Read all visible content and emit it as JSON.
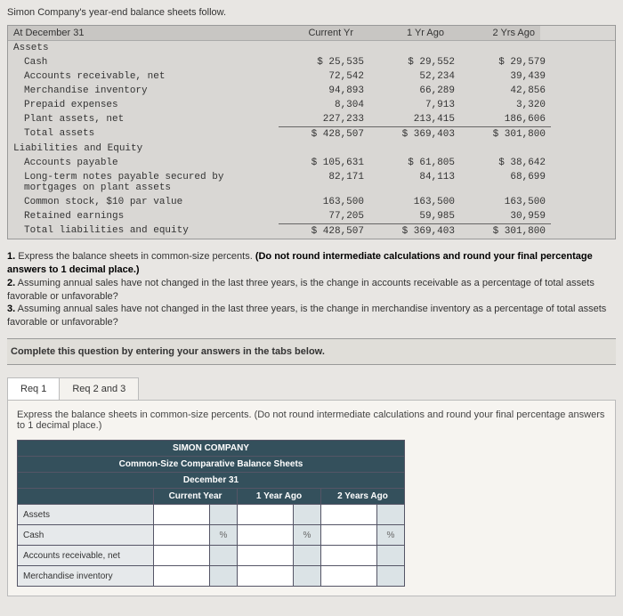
{
  "title": "Simon Company's year-end balance sheets follow.",
  "bs": {
    "date_label": "At December 31",
    "cols": [
      "Current Yr",
      "1 Yr Ago",
      "2 Yrs Ago"
    ],
    "sections": {
      "assets_hdr": "Assets",
      "liab_hdr": "Liabilities and Equity"
    },
    "rows": {
      "cash": {
        "label": "Cash",
        "v": [
          "$ 25,535",
          "$ 29,552",
          "$ 29,579"
        ]
      },
      "ar": {
        "label": "Accounts receivable, net",
        "v": [
          "72,542",
          "52,234",
          "39,439"
        ]
      },
      "merch": {
        "label": "Merchandise inventory",
        "v": [
          "94,893",
          "66,289",
          "42,856"
        ]
      },
      "prepaid": {
        "label": "Prepaid expenses",
        "v": [
          "8,304",
          "7,913",
          "3,320"
        ]
      },
      "plant": {
        "label": "Plant assets, net",
        "v": [
          "227,233",
          "213,415",
          "186,606"
        ]
      },
      "total_assets": {
        "label": "Total assets",
        "v": [
          "$ 428,507",
          "$ 369,403",
          "$ 301,800"
        ]
      },
      "ap": {
        "label": "Accounts payable",
        "v": [
          "$ 105,631",
          "$ 61,805",
          "$ 38,642"
        ]
      },
      "ltn": {
        "label": "Long-term notes payable secured by mortgages on plant assets",
        "v": [
          "82,171",
          "84,113",
          "68,699"
        ]
      },
      "common": {
        "label": "Common stock, $10 par value",
        "v": [
          "163,500",
          "163,500",
          "163,500"
        ]
      },
      "re": {
        "label": "Retained earnings",
        "v": [
          "77,205",
          "59,985",
          "30,959"
        ]
      },
      "total_le": {
        "label": "Total liabilities and equity",
        "v": [
          "$ 428,507",
          "$ 369,403",
          "$ 301,800"
        ]
      }
    }
  },
  "q": {
    "q1a": "1.",
    "q1b": " Express the balance sheets in common-size percents. ",
    "q1c": "(Do not round intermediate calculations and round your final percentage answers to 1 decimal place.)",
    "q2a": "2.",
    "q2b": " Assuming annual sales have not changed in the last three years, is the change in accounts receivable as a percentage of total assets favorable or unfavorable?",
    "q3a": "3.",
    "q3b": " Assuming annual sales have not changed in the last three years, is the change in merchandise inventory as a percentage of total assets favorable or unfavorable?"
  },
  "complete": "Complete this question by entering your answers in the tabs below.",
  "tabs": {
    "t1": "Req 1",
    "t2": "Req 2 and 3"
  },
  "tab_instr": "Express the balance sheets in common-size percents. (Do not round intermediate calculations and round your final percentage answers to 1 decimal place.)",
  "ans": {
    "company": "SIMON COMPANY",
    "subtitle": "Common-Size Comparative Balance Sheets",
    "date": "December 31",
    "cols": [
      "Current Year",
      "1 Year Ago",
      "2 Years Ago"
    ],
    "rows": [
      "Assets",
      "Cash",
      "Accounts receivable, net",
      "Merchandise inventory"
    ],
    "pct": "%"
  }
}
